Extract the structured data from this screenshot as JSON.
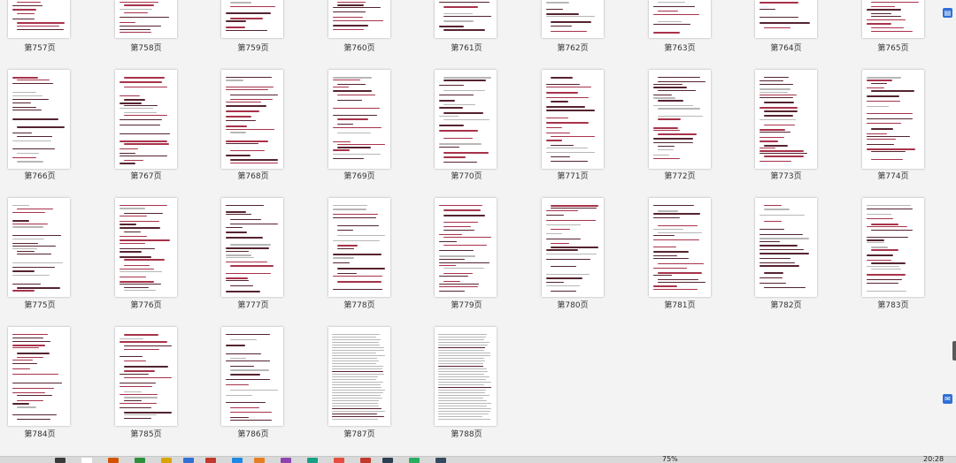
{
  "pages": {
    "row1": [
      "第757页",
      "第758页",
      "第759页",
      "第760页",
      "第761页",
      "第762页",
      "第763页",
      "第764页",
      "第765页"
    ],
    "row2": [
      "第766页",
      "第767页",
      "第768页",
      "第769页",
      "第770页",
      "第771页",
      "第772页",
      "第773页",
      "第774页"
    ],
    "row3": [
      "第775页",
      "第776页",
      "第777页",
      "第778页",
      "第779页",
      "第780页",
      "第781页",
      "第782页",
      "第783页"
    ],
    "row4": [
      "第784页",
      "第785页",
      "第786页",
      "第787页",
      "第788页"
    ]
  },
  "status": {
    "zoom": "75%",
    "time": "20:28"
  },
  "sidebar": {
    "top_icon": "document-icon",
    "bottom_icon": "chat-icon"
  },
  "colors": {
    "accent": "#2f6fd6",
    "text_dark": "#55232f",
    "text_red": "#a8324a"
  }
}
